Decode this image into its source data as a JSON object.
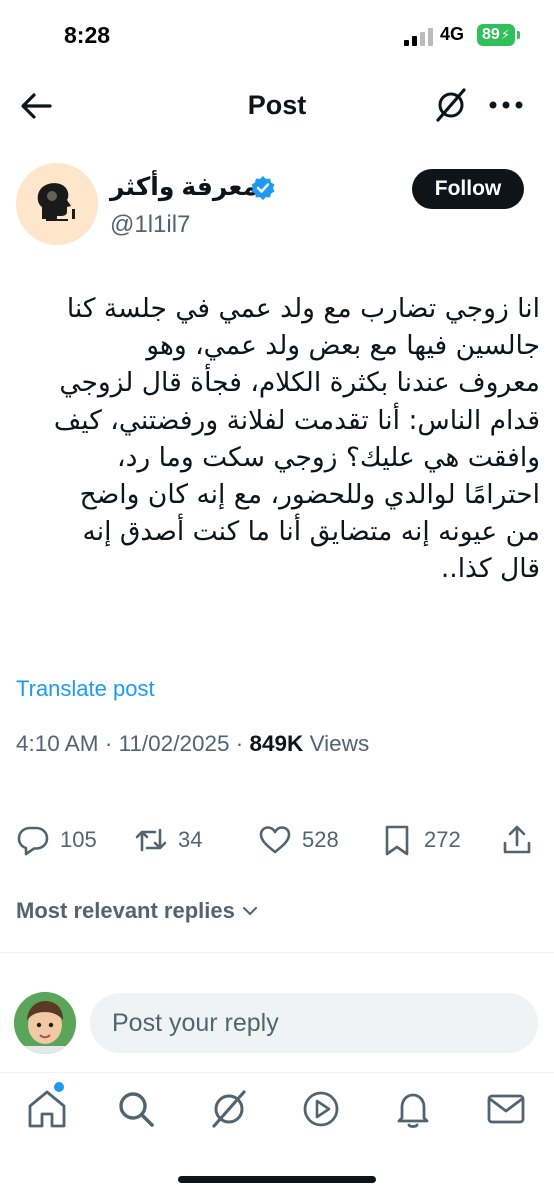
{
  "status_bar": {
    "time": "8:28",
    "network": "4G",
    "battery": "89"
  },
  "header": {
    "title": "Post"
  },
  "author": {
    "name": "معرفة وأكثر",
    "handle": "@1l1il7",
    "follow_label": "Follow"
  },
  "post": {
    "lines": [
      "انا زوجي تضارب مع ولد عمي في جلسة كنا",
      "جالسين فيها مع بعض ولد عمي، وهو",
      "معروف عندنا بكثرة الكلام، فجأة قال لزوجي",
      "قدام الناس: أنا تقدمت لفلانة ورفضتني، كيف",
      "وافقت هي عليك؟ زوجي سكت وما رد،",
      "احترامًا لوالدي وللحضور، مع إنه كان واضح",
      "من عيونه إنه متضايق أنا ما كنت أصدق إنه",
      "قال كذا.."
    ],
    "translate_label": "Translate post",
    "time": "4:10 AM",
    "date": "11/02/2025",
    "views_count": "849K",
    "views_label": "Views"
  },
  "actions": {
    "replies": "105",
    "reposts": "34",
    "likes": "528",
    "bookmarks": "272"
  },
  "replies_sort": {
    "label": "Most relevant replies"
  },
  "reply_box": {
    "placeholder": "Post your reply"
  },
  "colors": {
    "accent": "#1d9bf0",
    "text": "#0f1419",
    "muted": "#536471",
    "battery": "#30c05a"
  },
  "nav_icons": [
    "home-icon",
    "search-icon",
    "grok-icon",
    "videos-icon",
    "notifications-icon",
    "messages-icon"
  ]
}
